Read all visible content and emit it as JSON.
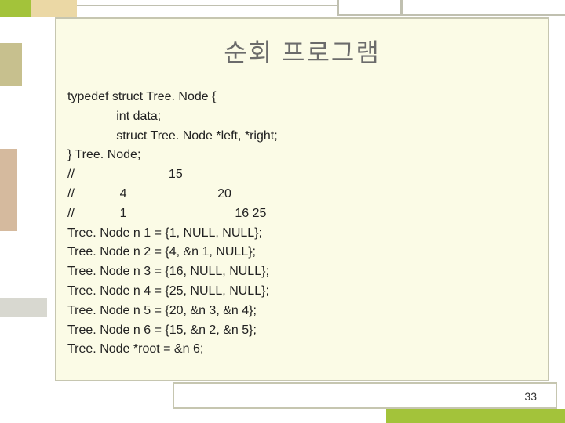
{
  "title": "순회 프로그램",
  "code_lines": [
    "typedef struct Tree. Node {",
    "              int data;",
    "              struct Tree. Node *left, *right;",
    "} Tree. Node;",
    "//                           15",
    "//             4                          20",
    "//             1                               16 25",
    "Tree. Node n 1 = {1, NULL, NULL};",
    "Tree. Node n 2 = {4, &n 1, NULL};",
    "Tree. Node n 3 = {16, NULL, NULL};",
    "Tree. Node n 4 = {25, NULL, NULL};",
    "Tree. Node n 5 = {20, &n 3, &n 4};",
    "Tree. Node n 6 = {15, &n 2, &n 5};",
    "Tree. Node *root = &n 6;"
  ],
  "page_number": "33"
}
